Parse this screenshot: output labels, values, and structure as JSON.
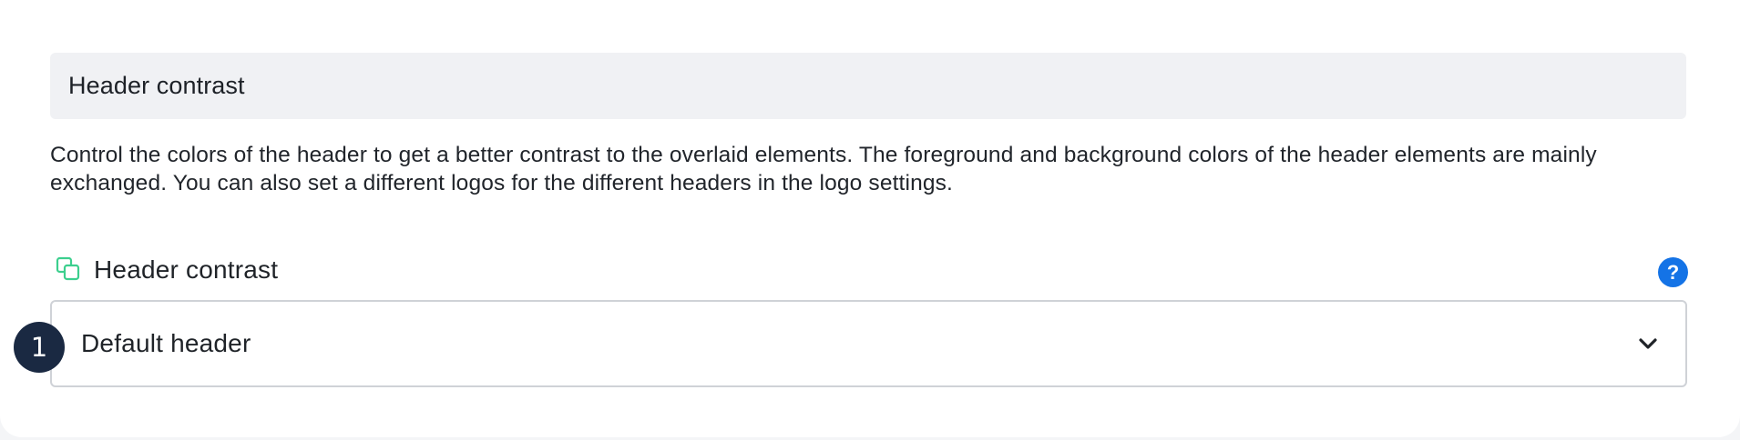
{
  "section": {
    "title": "Header contrast",
    "description": "Control the colors of the header to get a better contrast to the overlaid elements. The foreground and background colors of the header elements are mainly exchanged. You can also set a different logos for the different headers in the logo settings."
  },
  "field": {
    "label": "Header contrast",
    "label_icon": "copy-layers-icon",
    "help_icon": "question-icon",
    "help_text": "?",
    "select_value": "Default header",
    "dropdown_icon": "chevron-down-icon"
  },
  "badge": {
    "number": "1"
  },
  "colors": {
    "section_header_bg": "#f0f1f4",
    "accent_green": "#3ccf8e",
    "help_blue": "#1473e6",
    "badge_navy": "#1a2942",
    "border": "#cfd2d7"
  }
}
